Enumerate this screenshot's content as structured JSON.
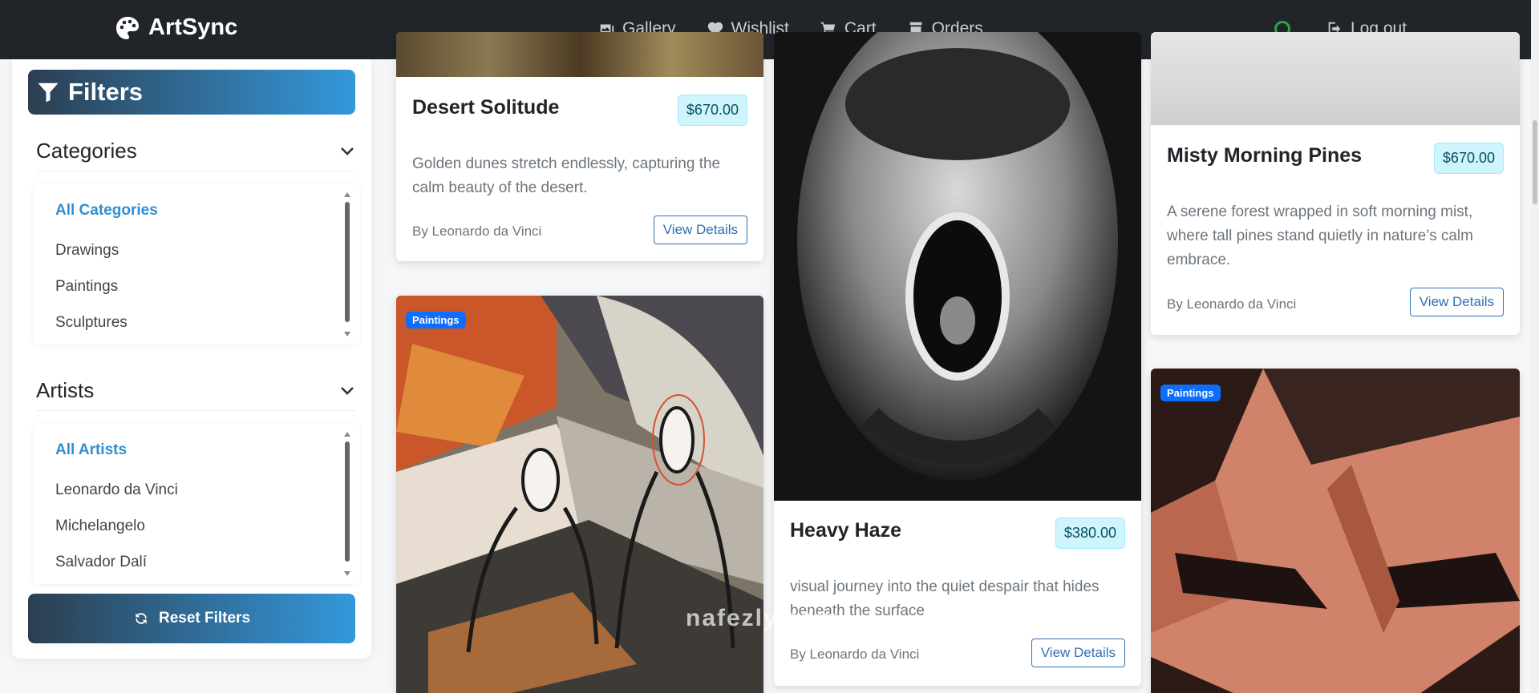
{
  "navbar": {
    "brand": "ArtSync",
    "links": [
      {
        "label": "Gallery",
        "icon": "images-icon"
      },
      {
        "label": "Wishlist",
        "icon": "heart-icon"
      },
      {
        "label": "Cart",
        "icon": "cart-icon"
      },
      {
        "label": "Orders",
        "icon": "box-icon"
      }
    ],
    "logout_label": "Log out",
    "search_icon_color": "#28a745"
  },
  "sidebar": {
    "title": "Filters",
    "categories": {
      "title": "Categories",
      "items": [
        "All Categories",
        "Drawings",
        "Paintings",
        "Sculptures"
      ],
      "active": "All Categories"
    },
    "artists": {
      "title": "Artists",
      "items": [
        "All Artists",
        "Leonardo da Vinci",
        "Michelangelo",
        "Salvador Dalí"
      ],
      "active": "All Artists"
    },
    "reset_label": "Reset Filters"
  },
  "cards": [
    {
      "title": "Desert Solitude",
      "price": "$670.00",
      "description": "Golden dunes stretch endlessly, capturing the calm beauty of the desert.",
      "artist": "By Leonardo da Vinci",
      "button": "View Details"
    },
    {
      "badge": "Paintings"
    },
    {
      "title": "Heavy Haze",
      "price": "$380.00",
      "description": "visual journey into the quiet despair that hides beneath the surface",
      "artist": "By Leonardo da Vinci",
      "button": "View Details"
    },
    {
      "title": "Misty Morning Pines",
      "price": "$670.00",
      "description": "A serene forest wrapped in soft morning mist, where tall pines stand quietly in nature’s calm embrace.",
      "artist": "By Leonardo da Vinci",
      "button": "View Details"
    },
    {
      "badge": "Paintings"
    }
  ],
  "colors": {
    "navbar_bg": "#212529",
    "accent_gradient_start": "#2c3e50",
    "accent_gradient_end": "#3498db",
    "price_bg": "#cff4fc",
    "badge_bg": "#0d6efd"
  },
  "watermark": "nafezly.com"
}
